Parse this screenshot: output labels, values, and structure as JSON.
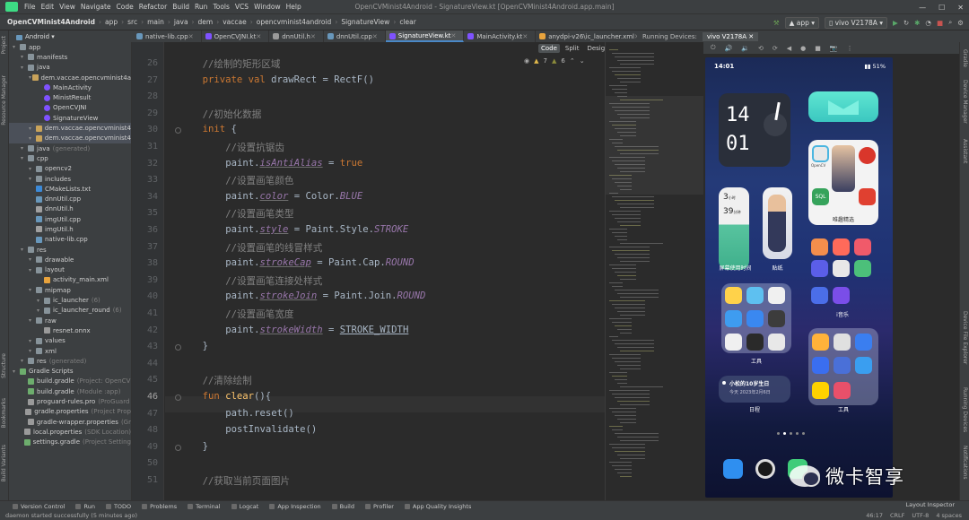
{
  "window": {
    "title": "OpenCVMinist4Android - SignatureView.kt [OpenCVMinist4Android.app.main]",
    "menu": [
      "File",
      "Edit",
      "View",
      "Navigate",
      "Code",
      "Refactor",
      "Build",
      "Run",
      "Tools",
      "VCS",
      "Window",
      "Help"
    ]
  },
  "navbar": {
    "crumbs": [
      "OpenCVMinist4Android",
      "app",
      "src",
      "main",
      "java",
      "dem",
      "vaccae",
      "opencvminist4android",
      "SignatureView",
      "clear"
    ],
    "run_config": "app",
    "device": "vivo V2178A"
  },
  "project_view": {
    "label": "Android"
  },
  "tabs": [
    "native-lib.cpp",
    "OpenCVJNI.kt",
    "dnnUtil.h",
    "dnnUtil.cpp",
    "SignatureView.kt",
    "MainActivity.kt",
    "anydpi-v26\\ic_launcher.xml"
  ],
  "active_tab": "SignatureView.kt",
  "editor_modes": [
    "Code",
    "Split",
    "Design"
  ],
  "inspections": {
    "warnings": "7",
    "weak": "6"
  },
  "device_panel": {
    "title": "Running Devices:",
    "device_tab": "vivo V2178A"
  },
  "tree": [
    {
      "indent": 0,
      "icon": "folder",
      "label": "app",
      "dim": ""
    },
    {
      "indent": 1,
      "icon": "folder",
      "label": "manifests",
      "dim": ""
    },
    {
      "indent": 1,
      "icon": "folder",
      "label": "java",
      "dim": ""
    },
    {
      "indent": 2,
      "icon": "package",
      "label": "dem.vaccae.opencvminist4a",
      "dim": ""
    },
    {
      "indent": 3,
      "icon": "kotlin",
      "label": "MainActivity",
      "dim": ""
    },
    {
      "indent": 3,
      "icon": "kotlin",
      "label": "MinistResult",
      "dim": ""
    },
    {
      "indent": 3,
      "icon": "kotlin",
      "label": "OpenCVJNI",
      "dim": ""
    },
    {
      "indent": 3,
      "icon": "kotlin",
      "label": "SignatureView",
      "dim": ""
    },
    {
      "indent": 2,
      "icon": "package",
      "label": "dem.vaccae.opencvminist4",
      "dim": "",
      "sel": true
    },
    {
      "indent": 2,
      "icon": "package",
      "label": "dem.vaccae.opencvminist4",
      "dim": "",
      "sel": true
    },
    {
      "indent": 1,
      "icon": "folder",
      "label": "java",
      "dim": "(generated)"
    },
    {
      "indent": 1,
      "icon": "folder",
      "label": "cpp",
      "dim": ""
    },
    {
      "indent": 2,
      "icon": "folder",
      "label": "opencv2",
      "dim": ""
    },
    {
      "indent": 2,
      "icon": "folder",
      "label": "includes",
      "dim": ""
    },
    {
      "indent": 2,
      "icon": "cmake",
      "label": "CMakeLists.txt",
      "dim": ""
    },
    {
      "indent": 2,
      "icon": "cpp",
      "label": "dnnUtil.cpp",
      "dim": ""
    },
    {
      "indent": 2,
      "icon": "h",
      "label": "dnnUtil.h",
      "dim": ""
    },
    {
      "indent": 2,
      "icon": "cpp",
      "label": "imgUtil.cpp",
      "dim": ""
    },
    {
      "indent": 2,
      "icon": "h",
      "label": "imgUtil.h",
      "dim": ""
    },
    {
      "indent": 2,
      "icon": "cpp",
      "label": "native-lib.cpp",
      "dim": ""
    },
    {
      "indent": 1,
      "icon": "folder",
      "label": "res",
      "dim": ""
    },
    {
      "indent": 2,
      "icon": "folder",
      "label": "drawable",
      "dim": ""
    },
    {
      "indent": 2,
      "icon": "folder",
      "label": "layout",
      "dim": ""
    },
    {
      "indent": 3,
      "icon": "xml",
      "label": "activity_main.xml",
      "dim": ""
    },
    {
      "indent": 2,
      "icon": "folder",
      "label": "mipmap",
      "dim": ""
    },
    {
      "indent": 3,
      "icon": "folder",
      "label": "ic_launcher",
      "dim": "(6)"
    },
    {
      "indent": 3,
      "icon": "folder",
      "label": "ic_launcher_round",
      "dim": "(6)"
    },
    {
      "indent": 2,
      "icon": "folder",
      "label": "raw",
      "dim": ""
    },
    {
      "indent": 3,
      "icon": "file",
      "label": "resnet.onnx",
      "dim": ""
    },
    {
      "indent": 2,
      "icon": "folder",
      "label": "values",
      "dim": ""
    },
    {
      "indent": 2,
      "icon": "folder",
      "label": "xml",
      "dim": ""
    },
    {
      "indent": 1,
      "icon": "folder",
      "label": "res",
      "dim": "(generated)"
    },
    {
      "indent": 0,
      "icon": "gradle",
      "label": "Gradle Scripts",
      "dim": ""
    },
    {
      "indent": 1,
      "icon": "gradle",
      "label": "build.gradle",
      "dim": "(Project: OpenCV"
    },
    {
      "indent": 1,
      "icon": "gradle",
      "label": "build.gradle",
      "dim": "(Module :app)"
    },
    {
      "indent": 1,
      "icon": "file",
      "label": "proguard-rules.pro",
      "dim": "(ProGuard"
    },
    {
      "indent": 1,
      "icon": "file",
      "label": "gradle.properties",
      "dim": "(Project Prop"
    },
    {
      "indent": 1,
      "icon": "file",
      "label": "gradle-wrapper.properties",
      "dim": "(Gr"
    },
    {
      "indent": 1,
      "icon": "file",
      "label": "local.properties",
      "dim": "(SDK Location)"
    },
    {
      "indent": 1,
      "icon": "gradle",
      "label": "settings.gradle",
      "dim": "(Project Setting"
    }
  ],
  "code": {
    "first_line": 26,
    "current_line": 46,
    "lines": [
      [
        {
          "t": "//绘制的矩形区域",
          "c": "cm",
          "i": 4
        }
      ],
      [
        {
          "t": "private val ",
          "c": "kw",
          "i": 4
        },
        {
          "t": "drawRect = RectF()",
          "c": "",
          "i": 0
        }
      ],
      [],
      [
        {
          "t": "//初始化数据",
          "c": "cm",
          "i": 4
        }
      ],
      [
        {
          "t": "init ",
          "c": "kw",
          "i": 4
        },
        {
          "t": "{",
          "c": "",
          "i": 0
        }
      ],
      [
        {
          "t": "//设置抗锯齿",
          "c": "cm",
          "i": 8
        }
      ],
      [
        {
          "t": "paint.",
          "c": "",
          "i": 8
        },
        {
          "t": "isAntiAlias",
          "c": "pr",
          "i": 0
        },
        {
          "t": " = ",
          "c": "",
          "i": 0
        },
        {
          "t": "true",
          "c": "kw",
          "i": 0
        }
      ],
      [
        {
          "t": "//设置画笔颜色",
          "c": "cm",
          "i": 8
        }
      ],
      [
        {
          "t": "paint.",
          "c": "",
          "i": 8
        },
        {
          "t": "color",
          "c": "pr",
          "i": 0
        },
        {
          "t": " = Color.",
          "c": "",
          "i": 0
        },
        {
          "t": "BLUE",
          "c": "cn",
          "i": 0
        }
      ],
      [
        {
          "t": "//设置画笔类型",
          "c": "cm",
          "i": 8
        }
      ],
      [
        {
          "t": "paint.",
          "c": "",
          "i": 8
        },
        {
          "t": "style",
          "c": "pr",
          "i": 0
        },
        {
          "t": " = Paint.Style.",
          "c": "",
          "i": 0
        },
        {
          "t": "STROKE",
          "c": "cn",
          "i": 0
        }
      ],
      [
        {
          "t": "//设置画笔的线冒样式",
          "c": "cm",
          "i": 8
        }
      ],
      [
        {
          "t": "paint.",
          "c": "",
          "i": 8
        },
        {
          "t": "strokeCap",
          "c": "pr",
          "i": 0
        },
        {
          "t": " = Paint.Cap.",
          "c": "",
          "i": 0
        },
        {
          "t": "ROUND",
          "c": "cn",
          "i": 0
        }
      ],
      [
        {
          "t": "//设置画笔连接处样式",
          "c": "cm",
          "i": 8
        }
      ],
      [
        {
          "t": "paint.",
          "c": "",
          "i": 8
        },
        {
          "t": "strokeJoin",
          "c": "pr",
          "i": 0
        },
        {
          "t": " = Paint.Join.",
          "c": "",
          "i": 0
        },
        {
          "t": "ROUND",
          "c": "cn",
          "i": 0
        }
      ],
      [
        {
          "t": "//设置画笔宽度",
          "c": "cm",
          "i": 8
        }
      ],
      [
        {
          "t": "paint.",
          "c": "",
          "i": 8
        },
        {
          "t": "strokeWidth",
          "c": "pr",
          "i": 0
        },
        {
          "t": " = ",
          "c": "",
          "i": 0
        },
        {
          "t": "STROKE_WIDTH",
          "c": "ul",
          "i": 0
        }
      ],
      [
        {
          "t": "}",
          "c": "",
          "i": 4
        }
      ],
      [],
      [
        {
          "t": "//清除绘制",
          "c": "cm",
          "i": 4
        }
      ],
      [
        {
          "t": "fun ",
          "c": "kw",
          "i": 4
        },
        {
          "t": "clear",
          "c": "fn",
          "i": 0
        },
        {
          "t": "(){",
          "c": "",
          "i": 0
        }
      ],
      [
        {
          "t": "path.reset()",
          "c": "",
          "i": 8
        }
      ],
      [
        {
          "t": "postInvalidate()",
          "c": "",
          "i": 8
        }
      ],
      [
        {
          "t": "}",
          "c": "",
          "i": 4
        }
      ],
      [],
      [
        {
          "t": "//获取当前页面图片",
          "c": "cm",
          "i": 4
        }
      ]
    ]
  },
  "phone": {
    "time": "14:01",
    "battery": "51%",
    "clock_hour": "14",
    "clock_min": "01",
    "stat_top": "3",
    "stat_top_unit": "小时",
    "stat_bottom": "39",
    "stat_bottom_unit": "分钟",
    "label_screen_time": "屏幕使用时间",
    "label_sticker": "贴纸",
    "label_featured": "唯趣精选",
    "label_tools1": "工具",
    "label_tools2": "工具",
    "label_music": "i音乐",
    "label_schedule": "日程",
    "birthday_title": "小松的10岁生日",
    "birthday_date": "今天 2023年2月6日",
    "sql_text": "SQL",
    "opencv_text": "OpenCV"
  },
  "watermark": {
    "text": "微卡智享"
  },
  "bottom_tabs": [
    "Version Control",
    "Run",
    "TODO",
    "Problems",
    "Terminal",
    "Logcat",
    "App Inspection",
    "Build",
    "Profiler",
    "App Quality Insights"
  ],
  "bottom_right_tab": "Layout Inspector",
  "status": {
    "message": "daemon started successfully (5 minutes ago)",
    "position": "46:17",
    "line_sep": "CRLF",
    "encoding": "UTF-8",
    "indent": "4 spaces"
  },
  "side_labels": {
    "left_top": "Project",
    "left_mid": "Resource Manager",
    "left_b1": "Structure",
    "left_b2": "Bookmarks",
    "left_b3": "Build Variants",
    "right_top": "Gradle",
    "right_2": "Device Manager",
    "right_3": "Assistant",
    "right_4": "Device File Explorer",
    "right_5": "Running Devices",
    "right_6": "Notifications"
  },
  "colors": {
    "kotlin_icon": "#7f52ff",
    "folder_icon": "#87939a",
    "package_icon": "#c9a35a",
    "accent": "#4a88c7"
  }
}
